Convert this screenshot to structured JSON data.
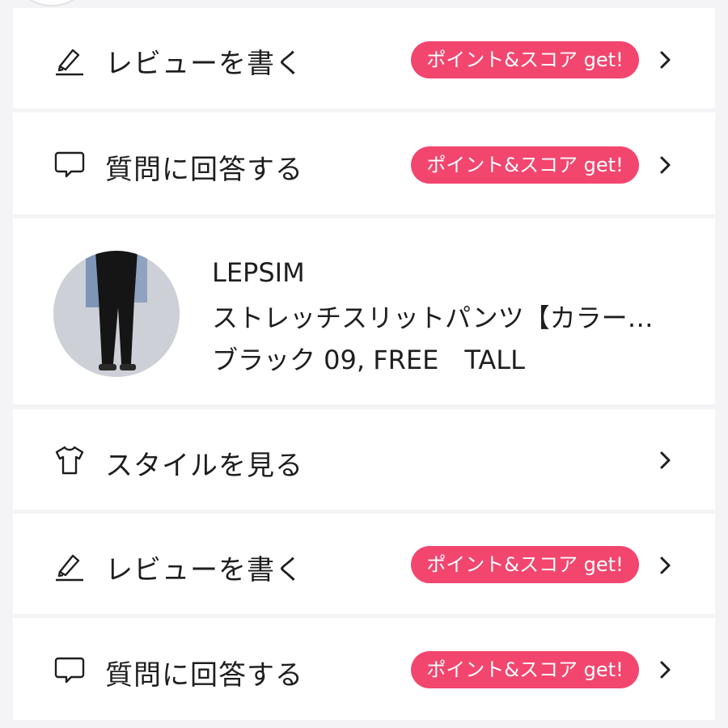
{
  "rows": {
    "review_1": {
      "label": "レビューを書く",
      "badge": "ポイント&スコア get!",
      "icon": "pencil-icon"
    },
    "question_1": {
      "label": "質問に回答する",
      "badge": "ポイント&スコア get!",
      "icon": "speech-bubble-icon"
    },
    "style": {
      "label": "スタイルを見る",
      "icon": "tshirt-icon"
    },
    "review_2": {
      "label": "レビューを書く",
      "badge": "ポイント&スコア get!",
      "icon": "pencil-icon"
    },
    "question_2": {
      "label": "質問に回答する",
      "badge": "ポイント&スコア get!",
      "icon": "speech-bubble-icon"
    }
  },
  "product": {
    "brand": "LEPSIM",
    "name": "ストレッチスリットパンツ【カラー…",
    "variant": "ブラック 09, FREE　TALL"
  },
  "colors": {
    "badge": "#f2466f",
    "background": "#f4f4f6",
    "card": "#ffffff"
  }
}
